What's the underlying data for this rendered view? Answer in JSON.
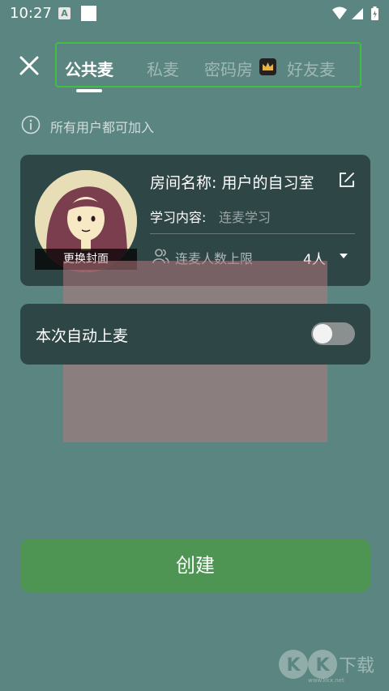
{
  "status_bar": {
    "time": "10:27",
    "notification_letter": "A"
  },
  "tabs": [
    {
      "label": "公共麦",
      "active": true
    },
    {
      "label": "私麦",
      "active": false
    },
    {
      "label": "密码房",
      "active": false
    },
    {
      "label": "好友麦",
      "active": false
    }
  ],
  "info": {
    "text": "所有用户都可加入"
  },
  "room": {
    "cover_button": "更换封面",
    "name_label": "房间名称: 用户的自习室",
    "study_label": "学习内容:",
    "study_placeholder": "连麦学习",
    "limit_label": "连麦人数上限",
    "limit_value": "4人"
  },
  "auto": {
    "label": "本次自动上麦",
    "enabled": false
  },
  "create_button": "创建",
  "watermark": {
    "text": "KK下载",
    "url": "www.kkx.net"
  },
  "colors": {
    "background": "#5a8580",
    "card": "#2f4646",
    "accent_green": "#4e9554",
    "tab_highlight_border": "#3fbf3f"
  }
}
